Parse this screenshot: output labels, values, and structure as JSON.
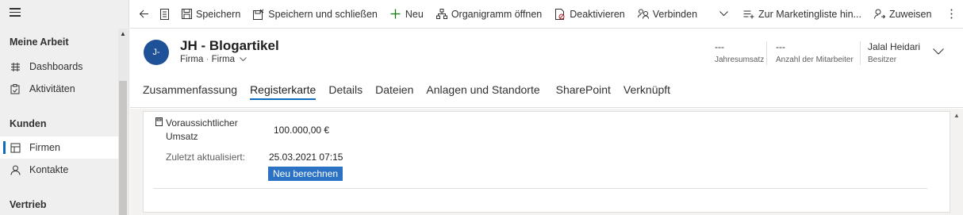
{
  "sidebar": {
    "groups": [
      {
        "label": "Meine Arbeit"
      },
      {
        "label": "Kunden"
      },
      {
        "label": "Vertrieb"
      }
    ],
    "items": [
      {
        "label": "Dashboards",
        "icon": "dashboard-icon"
      },
      {
        "label": "Aktivitäten",
        "icon": "activities-icon"
      },
      {
        "label": "Firmen",
        "icon": "accounts-icon",
        "active": true
      },
      {
        "label": "Kontakte",
        "icon": "contact-icon"
      }
    ]
  },
  "commandbar": {
    "save": "Speichern",
    "save_close": "Speichern und schließen",
    "new": "Neu",
    "org_chart": "Organigramm öffnen",
    "deactivate": "Deaktivieren",
    "connect": "Verbinden",
    "marketing_list": "Zur Marketingliste hin...",
    "assign": "Zuweisen"
  },
  "header": {
    "avatar_initials": "J-",
    "title": "JH - Blogartikel",
    "entity": "Firma",
    "form": "Firma",
    "kpis": [
      {
        "value": "---",
        "label": "Jahresumsatz"
      },
      {
        "value": "---",
        "label": "Anzahl der Mitarbeiter"
      }
    ],
    "owner": {
      "name": "Jalal Heidari",
      "label": "Besitzer"
    }
  },
  "tabs": [
    {
      "label": "Zusammenfassung"
    },
    {
      "label": "Registerkarte",
      "active": true
    },
    {
      "label": "Details"
    },
    {
      "label": "Dateien"
    },
    {
      "label": "Anlagen und Standorte"
    },
    {
      "label": "SharePoint"
    },
    {
      "label": "Verknüpft"
    }
  ],
  "form": {
    "revenue_label_line1": "Voraussichtlicher",
    "revenue_label_line2": "Umsatz",
    "revenue_value": "100.000,00 €",
    "updated_label": "Zuletzt aktualisiert:",
    "updated_value": "25.03.2021 07:15",
    "recalc_button": "Neu berechnen"
  },
  "colors": {
    "accent": "#0f6cbd",
    "avatar": "#1f5199",
    "button": "#2b72c4",
    "sidebar_bg": "#efefef"
  }
}
